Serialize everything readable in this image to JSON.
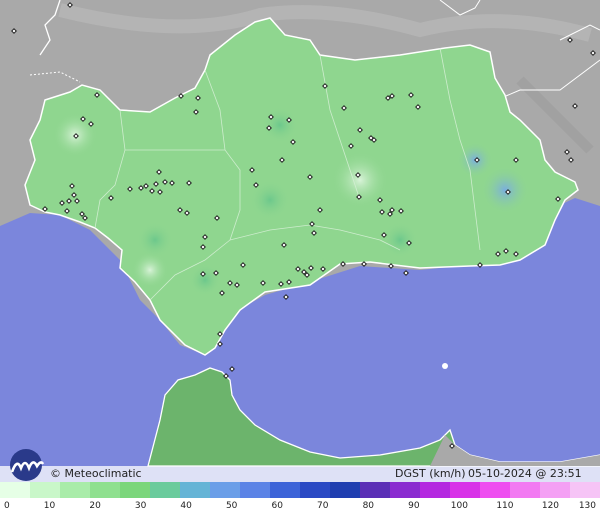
{
  "credit": {
    "brand": "© Meteoclimatic",
    "variable": "DGST (km/h)",
    "timestamp": "05-10-2024 @ 23:51 UTC"
  },
  "colors": {
    "sea": "#7b86dc",
    "land_outside": "#a9a9a9",
    "region": "#8fd68f",
    "africa": "#6cb46c",
    "border": "#ffffff",
    "station_fill": "#ffffff",
    "station_stroke": "#111111"
  },
  "legend": {
    "ticks": [
      "0",
      "10",
      "20",
      "30",
      "40",
      "50",
      "60",
      "70",
      "80",
      "90",
      "100",
      "110",
      "120",
      "130"
    ],
    "colors": [
      "#e6ffe6",
      "#c9f7c9",
      "#a9eca9",
      "#8fe08f",
      "#7bd67b",
      "#6acb9c",
      "#65b4d6",
      "#6a9ee8",
      "#5b83e6",
      "#3c63d8",
      "#2a49c4",
      "#1f3eb0",
      "#5b2fb6",
      "#8a2bd0",
      "#b428e0",
      "#d832e8",
      "#ee4ef0",
      "#f27af2",
      "#f4a0f4",
      "#f6c4f6"
    ]
  },
  "icons": {
    "logo": "meteoclimatic-logo-icon",
    "station": "station-marker-icon"
  }
}
